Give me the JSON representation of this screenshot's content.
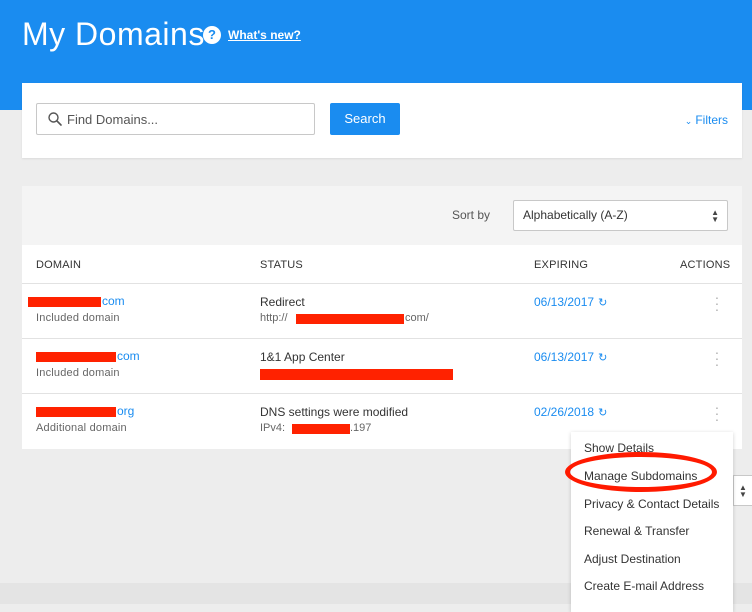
{
  "header": {
    "title": "My Domains",
    "help_icon": "?",
    "whats_new": "What's new?"
  },
  "search": {
    "placeholder": "Find Domains...",
    "button": "Search",
    "filters": "Filters",
    "filters_icon": "chevron-down-icon"
  },
  "table": {
    "sort_label": "Sort by",
    "sort_value": "Alphabetically (A-Z)",
    "columns": [
      "DOMAIN",
      "STATUS",
      "EXPIRING",
      "ACTIONS"
    ],
    "rows": [
      {
        "domain_suffix": "com",
        "domain_type": "Included domain",
        "status": "Redirect",
        "status_detail_prefix": "http://",
        "status_detail_suffix": "com/",
        "expiring": "06/13/2017"
      },
      {
        "domain_suffix": "com",
        "domain_type": "Included domain",
        "status": "1&1 App Center",
        "status_detail_prefix": "",
        "status_detail_suffix": "",
        "expiring": "06/13/2017"
      },
      {
        "domain_suffix": "org",
        "domain_type": "Additional domain",
        "status": "DNS settings were modified",
        "status_detail_prefix": "IPv4:",
        "status_detail_suffix": ".197",
        "expiring": "02/26/2018"
      }
    ]
  },
  "actions_menu": {
    "items": [
      "Show Details",
      "Manage Subdomains",
      "Privacy & Contact Details",
      "Renewal & Transfer",
      "Adjust Destination",
      "Create E-mail Address"
    ],
    "highlighted_item": "Manage Subdomains"
  },
  "colors": {
    "brand_blue": "#1a8cf0",
    "redaction_red": "#ff2200",
    "highlight_red": "#ff1a00"
  }
}
